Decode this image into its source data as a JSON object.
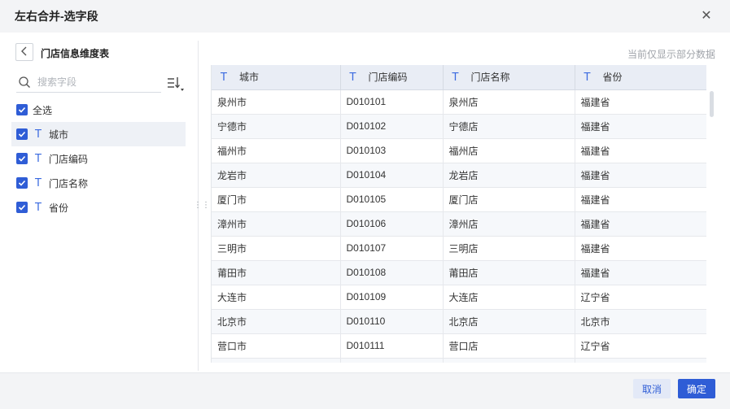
{
  "dialog": {
    "title": "左右合并-选字段",
    "close_glyph": "✕"
  },
  "left_panel": {
    "back_glyph": "‹",
    "table_name": "门店信息维度表",
    "search": {
      "placeholder": "搜索字段"
    },
    "select_all": "全选",
    "fields": [
      {
        "label": "城市",
        "checked": true,
        "active": true,
        "type_glyph": "T"
      },
      {
        "label": "门店编码",
        "checked": true,
        "active": false,
        "type_glyph": "T"
      },
      {
        "label": "门店名称",
        "checked": true,
        "active": false,
        "type_glyph": "T"
      },
      {
        "label": "省份",
        "checked": true,
        "active": false,
        "type_glyph": "T"
      }
    ]
  },
  "preview": {
    "note": "当前仅显示部分数据",
    "columns": [
      "城市",
      "门店编码",
      "门店名称",
      "省份"
    ],
    "rows": [
      [
        "泉州市",
        "D010101",
        "泉州店",
        "福建省"
      ],
      [
        "宁德市",
        "D010102",
        "宁德店",
        "福建省"
      ],
      [
        "福州市",
        "D010103",
        "福州店",
        "福建省"
      ],
      [
        "龙岩市",
        "D010104",
        "龙岩店",
        "福建省"
      ],
      [
        "厦门市",
        "D010105",
        "厦门店",
        "福建省"
      ],
      [
        "漳州市",
        "D010106",
        "漳州店",
        "福建省"
      ],
      [
        "三明市",
        "D010107",
        "三明店",
        "福建省"
      ],
      [
        "莆田市",
        "D010108",
        "莆田店",
        "福建省"
      ],
      [
        "大连市",
        "D010109",
        "大连店",
        "辽宁省"
      ],
      [
        "北京市",
        "D010110",
        "北京店",
        "北京市"
      ],
      [
        "营口市",
        "D010111",
        "营口店",
        "辽宁省"
      ],
      [
        "",
        "",
        "",
        ""
      ]
    ]
  },
  "footer": {
    "cancel_label": "取消",
    "ok_label": "确定"
  },
  "colors": {
    "accent": "#2f5dd6",
    "header_bg": "#e9edf5",
    "title_bg": "#f3f4f6"
  }
}
